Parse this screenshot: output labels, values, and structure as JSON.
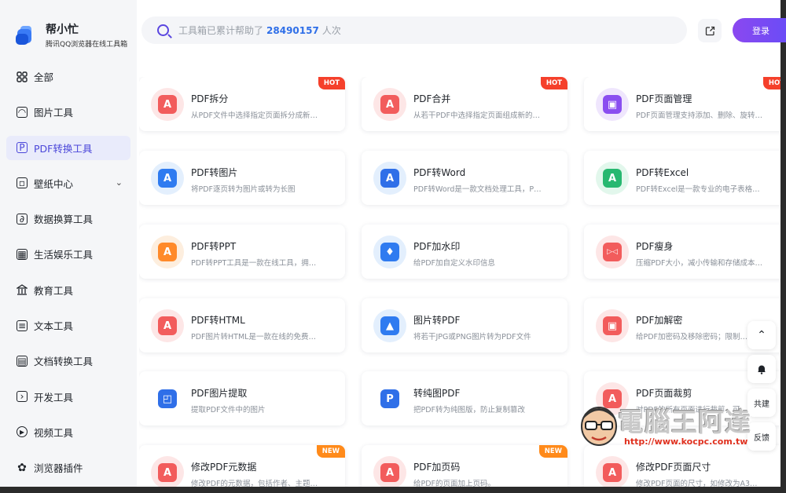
{
  "brand": {
    "title": "帮小忙",
    "subtitle": "腾讯QQ浏览器在线工具箱",
    "logo_icon": "stacked-blocks-logo"
  },
  "search": {
    "prefix": "工具箱已累计帮助了",
    "count": "28490157",
    "suffix": "人次"
  },
  "header": {
    "login_label": "登录",
    "share_icon": "share-icon"
  },
  "sidebar": {
    "items": [
      {
        "label": "全部",
        "icon": "grid-icon",
        "active": false
      },
      {
        "label": "图片工具",
        "icon": "image-icon",
        "active": false
      },
      {
        "label": "PDF转换工具",
        "icon": "pdf-icon",
        "active": true
      },
      {
        "label": "壁纸中心",
        "icon": "wallpaper-icon",
        "active": false
      },
      {
        "label": "数据换算工具",
        "icon": "calculator-icon",
        "active": false
      },
      {
        "label": "生活娱乐工具",
        "icon": "entertainment-icon",
        "active": false
      },
      {
        "label": "教育工具",
        "icon": "education-icon",
        "active": false
      },
      {
        "label": "文本工具",
        "icon": "text-icon",
        "active": false
      },
      {
        "label": "文档转换工具",
        "icon": "document-icon",
        "active": false
      },
      {
        "label": "开发工具",
        "icon": "code-icon",
        "active": false
      },
      {
        "label": "视频工具",
        "icon": "video-icon",
        "active": false
      },
      {
        "label": "浏览器插件",
        "icon": "plugin-icon",
        "active": false
      }
    ]
  },
  "cards": [
    {
      "title": "PDF拆分",
      "desc": "从PDF文件中选择指定页面拆分成新…",
      "badge": "HOT"
    },
    {
      "title": "PDF合并",
      "desc": "从若干PDF中选择指定页面组成新的…",
      "badge": "HOT"
    },
    {
      "title": "PDF页面管理",
      "desc": "PDF页面管理支持添加、删除、旋转…",
      "badge": "HOT"
    },
    {
      "title": "PDF转图片",
      "desc": "将PDF逐页转为图片或转为长图",
      "badge": ""
    },
    {
      "title": "PDF转Word",
      "desc": "PDF转Word是一款文档处理工具，P…",
      "badge": ""
    },
    {
      "title": "PDF转Excel",
      "desc": "PDF转Excel是一款专业的电子表格…",
      "badge": ""
    },
    {
      "title": "PDF转PPT",
      "desc": "PDF转PPT工具是一款在线工具，拥…",
      "badge": ""
    },
    {
      "title": "PDF加水印",
      "desc": "给PDF加自定义水印信息",
      "badge": ""
    },
    {
      "title": "PDF瘦身",
      "desc": "压缩PDF大小，减小传输和存储成本…",
      "badge": ""
    },
    {
      "title": "PDF转HTML",
      "desc": "PDF图片转HTML是一款在线的免费…",
      "badge": ""
    },
    {
      "title": "图片转PDF",
      "desc": "将若干JPG或PNG图片转为PDF文件",
      "badge": ""
    },
    {
      "title": "PDF加解密",
      "desc": "给PDF加密码及移除密码；限制…",
      "badge": ""
    },
    {
      "title": "PDF图片提取",
      "desc": "提取PDF文件中的图片",
      "badge": ""
    },
    {
      "title": "转纯图PDF",
      "desc": "把PDF转为纯图版，防止复制篡改",
      "badge": ""
    },
    {
      "title": "PDF页面裁剪",
      "desc": "对PDF的所有页面进行裁剪，可…",
      "badge": ""
    },
    {
      "title": "修改PDF元数据",
      "desc": "修改PDF的元数据，包括作者、主题…",
      "badge": "NEW"
    },
    {
      "title": "PDF加页码",
      "desc": "给PDF的页面加上页码。",
      "badge": "NEW"
    },
    {
      "title": "修改PDF页面尺寸",
      "desc": "修改PDF页面的尺寸，如修改为A3…",
      "badge": ""
    }
  ],
  "floating": {
    "top_icon": "back-to-top-icon",
    "bell_icon": "bell-icon",
    "share_label": "共建",
    "feedback_label": "反馈"
  },
  "watermark": {
    "text": "電腦王阿達",
    "url": "http://www.kocpc.com.tw"
  },
  "colors": {
    "accent": "#5a46e0",
    "hot": "#f5402b",
    "new": "#ff8a1a",
    "count": "#2f6fe8"
  }
}
